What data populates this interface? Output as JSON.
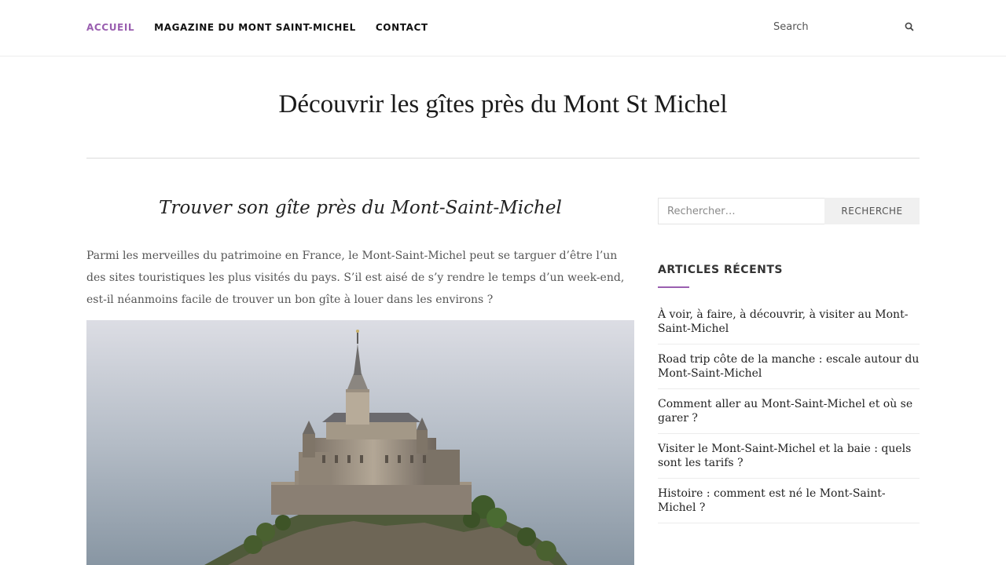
{
  "nav": {
    "items": [
      {
        "label": "ACCUEIL",
        "active": true
      },
      {
        "label": "MAGAZINE DU MONT SAINT-MICHEL",
        "active": false
      },
      {
        "label": "CONTACT",
        "active": false
      }
    ],
    "search_placeholder": "Search"
  },
  "page": {
    "title": "Découvrir les gîtes près du Mont St Michel"
  },
  "article": {
    "title": "Trouver son gîte près du Mont-Saint-Michel",
    "intro": "Parmi les merveilles du patrimoine en France, le Mont-Saint-Michel peut se targuer d’être l’un des sites touristiques les plus visités du pays. S’il est aisé de s’y rendre le temps d’un week-end, est-il néanmoins facile de trouver un bon gîte à louer dans les environs ?"
  },
  "sidebar": {
    "search_placeholder": "Rechercher…",
    "search_button": "RECHERCHE",
    "recent_title": "ARTICLES RÉCENTS",
    "recent_posts": [
      "À voir, à faire, à découvrir, à visiter au Mont-Saint-Michel",
      "Road trip côte de la manche : escale autour du Mont-Saint-Michel",
      "Comment aller au Mont-Saint-Michel et où se garer ?",
      "Visiter le Mont-Saint-Michel et la baie : quels sont les tarifs ?",
      "Histoire : comment est né le Mont-Saint-Michel ?"
    ]
  },
  "colors": {
    "accent": "#9a5fb0",
    "sky_top": "#d9dbe2",
    "sky_bottom": "#8f9eab"
  },
  "icons": {
    "search": "search-icon",
    "hero": "mont-saint-michel-photo"
  }
}
